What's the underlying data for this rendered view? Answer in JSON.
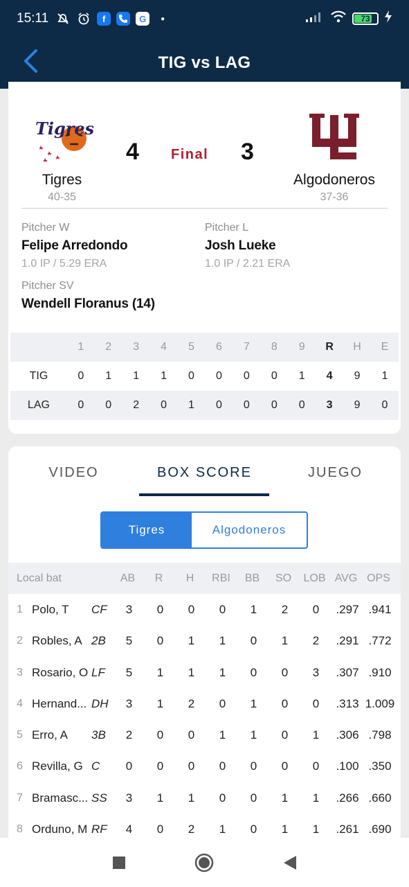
{
  "status_bar": {
    "time": "15:11",
    "battery": "73",
    "app_icons": [
      "muted-notifications-icon",
      "alarm-icon",
      "facebook-icon",
      "phone-icon",
      "google-icon"
    ]
  },
  "header": {
    "title": "TIG vs LAG"
  },
  "game": {
    "status": "Final",
    "home": {
      "name": "Tigres",
      "record": "40-35",
      "score": "4",
      "logo_text": "Tigres"
    },
    "away": {
      "name": "Algodoneros",
      "record": "37-36",
      "score": "3",
      "logo_text": "UL"
    }
  },
  "pitchers": {
    "win": {
      "label": "Pitcher W",
      "name": "Felipe Arredondo",
      "stat": "1.0 IP / 5.29 ERA"
    },
    "loss": {
      "label": "Pitcher L",
      "name": "Josh Lueke",
      "stat": "1.0 IP / 2.21 ERA"
    },
    "save": {
      "label": "Pitcher SV",
      "name": "Wendell Floranus (14)"
    }
  },
  "linescore": {
    "headers": [
      "1",
      "2",
      "3",
      "4",
      "5",
      "6",
      "7",
      "8",
      "9",
      "R",
      "H",
      "E"
    ],
    "rows": [
      {
        "team": "TIG",
        "cells": [
          "0",
          "1",
          "1",
          "1",
          "0",
          "0",
          "0",
          "0",
          "1",
          "4",
          "9",
          "1"
        ]
      },
      {
        "team": "LAG",
        "cells": [
          "0",
          "0",
          "2",
          "0",
          "1",
          "0",
          "0",
          "0",
          "0",
          "3",
          "9",
          "0"
        ]
      }
    ]
  },
  "tabs": [
    {
      "label": "VIDEO"
    },
    {
      "label": "BOX SCORE"
    },
    {
      "label": "JUEGO"
    }
  ],
  "team_toggle": {
    "home": "Tigres",
    "away": "Algodoneros"
  },
  "batting": {
    "label": "Local bat",
    "columns": [
      "AB",
      "R",
      "H",
      "RBI",
      "BB",
      "SO",
      "LOB",
      "AVG",
      "OPS"
    ],
    "rows": [
      {
        "num": "1",
        "name": "Polo, T",
        "pos": "CF",
        "stats": [
          "3",
          "0",
          "0",
          "0",
          "1",
          "2",
          "0",
          ".297",
          ".941"
        ]
      },
      {
        "num": "2",
        "name": "Robles, A",
        "pos": "2B",
        "stats": [
          "5",
          "0",
          "1",
          "1",
          "0",
          "1",
          "2",
          ".291",
          ".772"
        ]
      },
      {
        "num": "3",
        "name": "Rosario, O",
        "pos": "LF",
        "stats": [
          "5",
          "1",
          "1",
          "1",
          "0",
          "0",
          "3",
          ".307",
          ".910"
        ]
      },
      {
        "num": "4",
        "name": "Hernand...",
        "pos": "DH",
        "stats": [
          "3",
          "1",
          "2",
          "0",
          "1",
          "0",
          "0",
          ".313",
          "1.009"
        ]
      },
      {
        "num": "5",
        "name": "Erro, A",
        "pos": "3B",
        "stats": [
          "2",
          "0",
          "0",
          "1",
          "1",
          "0",
          "1",
          ".306",
          ".798"
        ]
      },
      {
        "num": "6",
        "name": "Revilla, G",
        "pos": "C",
        "stats": [
          "0",
          "0",
          "0",
          "0",
          "0",
          "0",
          "0",
          ".100",
          ".350"
        ]
      },
      {
        "num": "7",
        "name": "Bramasc...",
        "pos": "SS",
        "stats": [
          "3",
          "1",
          "1",
          "0",
          "0",
          "1",
          "1",
          ".266",
          ".660"
        ]
      },
      {
        "num": "8",
        "name": "Orduno, M",
        "pos": "RF",
        "stats": [
          "4",
          "0",
          "2",
          "1",
          "0",
          "1",
          "1",
          ".261",
          ".690"
        ]
      }
    ]
  },
  "colors": {
    "header_bg": "#0d2b47",
    "accent": "#2f7fde",
    "final_red": "#b01c2e",
    "away_maroon": "#7a1f2b"
  }
}
